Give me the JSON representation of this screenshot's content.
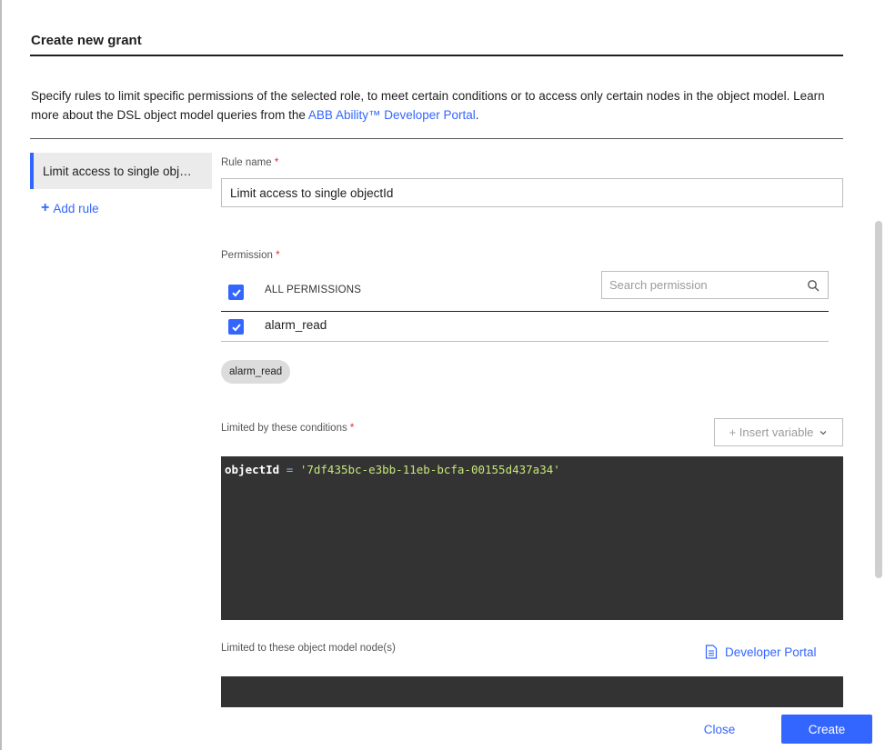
{
  "dialog": {
    "title": "Create new grant",
    "description_prefix": "Specify rules to limit specific permissions of the selected role, to meet certain conditions or to access only certain nodes in the object model. Learn more about the DSL object model queries from the ",
    "description_link": "ABB Ability™ Developer Portal",
    "description_suffix": "."
  },
  "rules": {
    "items": [
      {
        "label": "Limit access to single obj…"
      }
    ],
    "add_label": "Add rule"
  },
  "form": {
    "rule_name_label": "Rule name",
    "required_mark": "*",
    "rule_name_value": "Limit access to single objectId",
    "permission_label": "Permission",
    "all_permissions_label": "ALL PERMISSIONS",
    "search_placeholder": "Search permission",
    "permissions": [
      {
        "name": "alarm_read",
        "checked": true
      }
    ],
    "selected_chips": [
      "alarm_read"
    ],
    "conditions_label": "Limited by these conditions",
    "insert_variable_label": "+ Insert variable",
    "condition_code": {
      "identifier": "objectId",
      "operator": "=",
      "value": "'7df435bc-e3bb-11eb-bcfa-00155d437a34'"
    },
    "nodes_label": "Limited to these object model node(s)",
    "developer_portal_label": "Developer Portal"
  },
  "footer": {
    "close_label": "Close",
    "create_label": "Create"
  },
  "colors": {
    "accent": "#3366ff",
    "code_background": "#333333",
    "required": "#e12e2e"
  },
  "icons": [
    "search-icon",
    "checkbox-checked-icon",
    "plus-icon",
    "chevron-down-icon",
    "document-icon"
  ]
}
